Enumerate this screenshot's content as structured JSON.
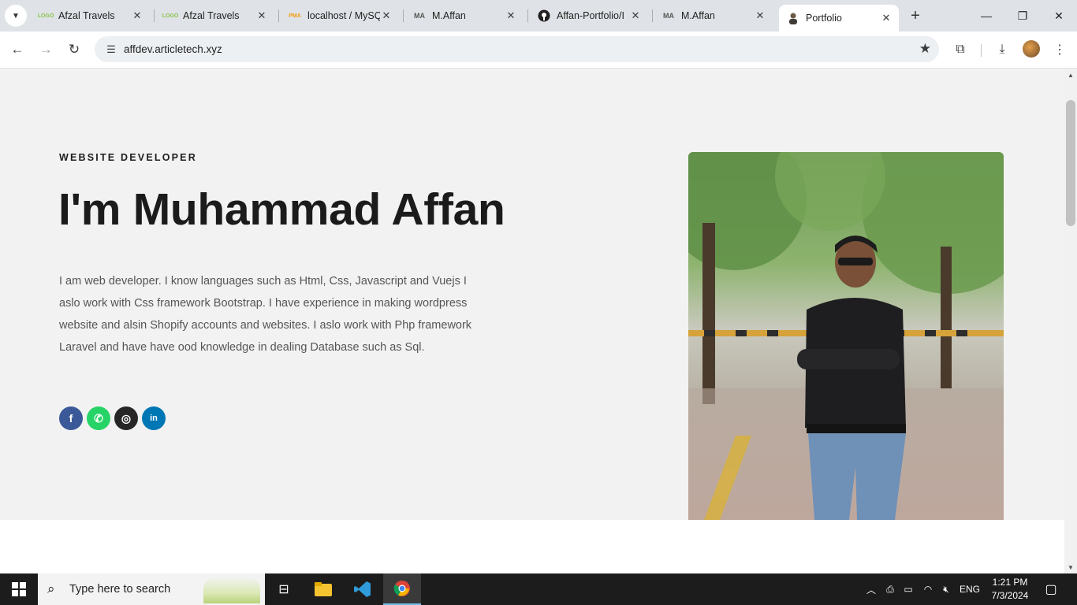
{
  "browser": {
    "tabs": [
      {
        "title": "Afzal Travels",
        "favicon": "logo-text-icon",
        "favicon_text": "LOGO"
      },
      {
        "title": "Afzal Travels",
        "favicon": "logo-text-icon",
        "favicon_text": "LOGO"
      },
      {
        "title": "localhost / MySQL",
        "favicon": "phpmyadmin-icon",
        "favicon_text": "PMA"
      },
      {
        "title": "M.Affan",
        "favicon": "ma-logo-icon",
        "favicon_text": "MA"
      },
      {
        "title": "Affan-Portfolio/I",
        "favicon": "github-icon",
        "favicon_text": ""
      },
      {
        "title": "M.Affan",
        "favicon": "ma-logo-icon",
        "favicon_text": "MA"
      },
      {
        "title": "Portfolio",
        "favicon": "person-icon",
        "favicon_text": "",
        "active": true
      }
    ],
    "url": "affdev.articletech.xyz"
  },
  "hero": {
    "eyebrow": "WEBSITE DEVELOPER",
    "headline": "I'm Muhammad Affan",
    "bio": "I am web developer. I know languages such as Html, Css, Javascript and Vuejs I aslo work with Css  framework Bootstrap. I have experience in making wordpress website and alsin Shopify accounts and websites. I aslo work with Php framework Laravel and have have ood knowledge in dealing Database such as Sql.",
    "social": [
      {
        "name": "facebook",
        "icon": "facebook-icon",
        "color": "#3b5998",
        "glyph": "f"
      },
      {
        "name": "whatsapp",
        "icon": "whatsapp-icon",
        "color": "#25d366",
        "glyph": "✆"
      },
      {
        "name": "instagram",
        "icon": "instagram-icon",
        "color": "#262626",
        "glyph": "◎"
      },
      {
        "name": "linkedin",
        "icon": "linkedin-icon",
        "color": "#0077b5",
        "glyph": "in"
      }
    ]
  },
  "taskbar": {
    "search_placeholder": "Type here to search",
    "language": "ENG",
    "time": "1:21 PM",
    "date": "7/3/2024"
  }
}
